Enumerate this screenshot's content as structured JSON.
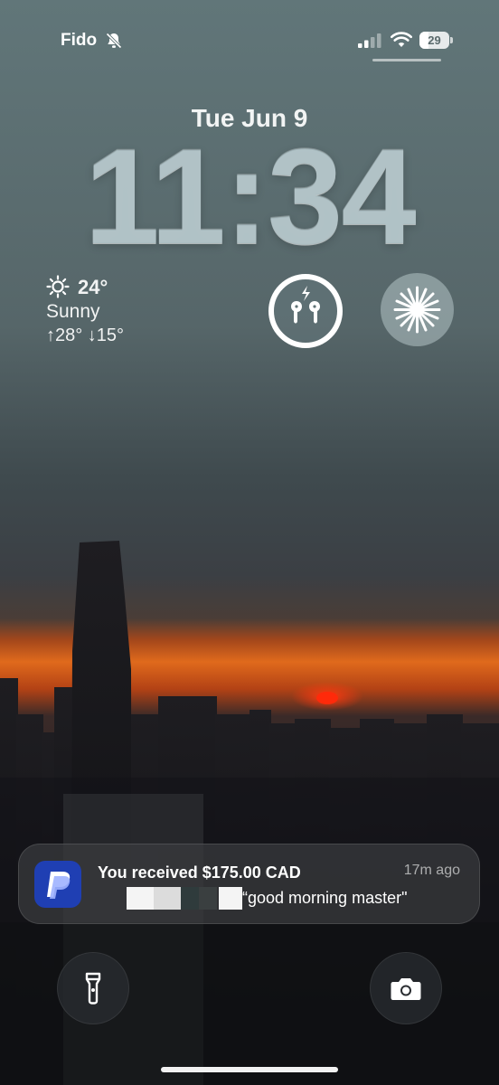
{
  "status_bar": {
    "carrier": "Fido",
    "battery_level": "29",
    "battery_fraction": 0.29,
    "icons": [
      "bell-slash-icon",
      "cellular-signal-icon",
      "wifi-icon",
      "battery-icon"
    ]
  },
  "lock_screen": {
    "date": "Tue Jun 9",
    "time": "11:34"
  },
  "weather_widget": {
    "icon": "sun-icon",
    "temperature": "24°",
    "condition": "Sunny",
    "high_low": "↑28° ↓15°"
  },
  "widgets": [
    "airpods-battery-icon",
    "perplexity-icon"
  ],
  "notification": {
    "app_icon": "paypal-icon",
    "title": "You received $175.00 CAD",
    "time": "17m ago",
    "message": "“good morning master\""
  },
  "quick_actions": {
    "left": "flashlight-icon",
    "right": "camera-icon"
  }
}
